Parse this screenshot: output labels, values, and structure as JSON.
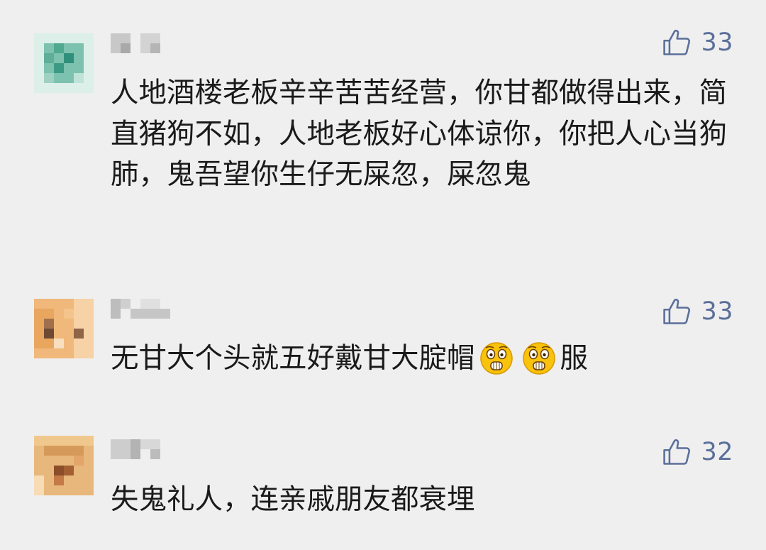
{
  "comments": [
    {
      "author": "",
      "likes": "33",
      "text": "人地酒楼老板辛辛苦苦经营，你甘都做得出来，简直猪狗不如，人地老板好心体谅你，你把人心当狗肺，鬼吾望你生仔无屎忽，屎忽鬼",
      "avatar_colors": [
        "#5fae98",
        "#9ed1c2",
        "#2f8f7a"
      ]
    },
    {
      "author": "",
      "likes": "33",
      "text_before": "无甘大个头就五好戴甘大腚帽",
      "emojis": [
        "scared-face-emoji",
        "scared-face-emoji"
      ],
      "text_after": "服",
      "avatar_colors": [
        "#e9a65f",
        "#f6d2a6",
        "#6f4a33"
      ]
    },
    {
      "author": "",
      "likes": "32",
      "text": "失鬼礼人，连亲戚朋友都衰埋",
      "avatar_colors": [
        "#d59a5a",
        "#f0c88e",
        "#8b4d2a"
      ]
    }
  ],
  "colors": {
    "background": "#efefef",
    "text": "#1a1a1a",
    "like": "#5b6f9a",
    "emoji_face": "#f9c20c"
  },
  "icons": {
    "like": "thumbs-up-icon"
  }
}
